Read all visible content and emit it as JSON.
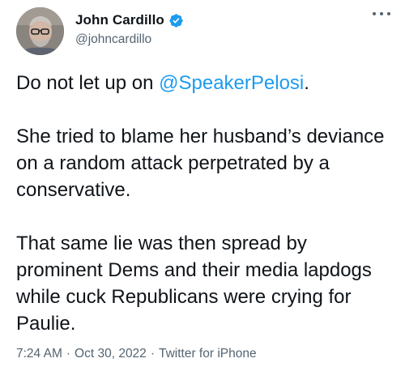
{
  "author": {
    "display_name": "John Cardillo",
    "handle": "@johncardillo",
    "verified": true
  },
  "tweet": {
    "paragraphs": [
      {
        "before": "Do not let up on ",
        "mention": "@SpeakerPelosi",
        "after": "."
      },
      {
        "text": "She tried to blame her husband’s deviance on a random attack perpetrated by a conservative."
      },
      {
        "text": "That same lie was then spread by prominent Dems and their media lapdogs while cuck Republicans were crying for Paulie."
      }
    ]
  },
  "meta": {
    "time": "7:24 AM",
    "separator1": "·",
    "date": "Oct 30, 2022",
    "separator2": "·",
    "source": "Twitter for iPhone"
  },
  "icons": {
    "verified": "verified-badge-icon",
    "more": "more-options-icon"
  },
  "colors": {
    "mention": "#1d9bf0",
    "verified": "#1d9bf0",
    "secondary_text": "#536471",
    "primary_text": "#0f1419"
  }
}
